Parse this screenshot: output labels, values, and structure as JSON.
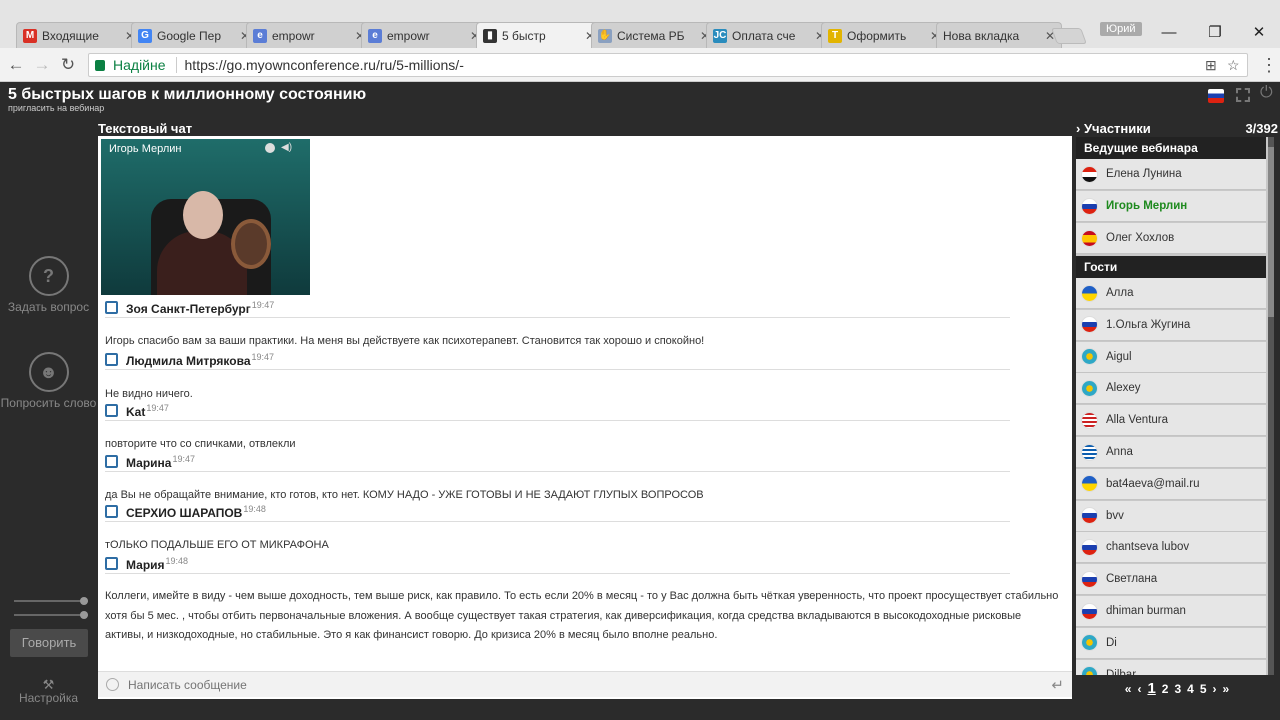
{
  "browser": {
    "tabs": [
      {
        "label": "Входящие",
        "icon": "gmail-icon",
        "color": "#d93025",
        "glyph": "M"
      },
      {
        "label": "Google Пер",
        "icon": "google-translate-icon",
        "color": "#4285f4",
        "glyph": "G"
      },
      {
        "label": "empowr",
        "icon": "empowr-icon",
        "color": "#5b7dd6",
        "glyph": "e"
      },
      {
        "label": "empowr",
        "icon": "empowr-icon",
        "color": "#5b7dd6",
        "glyph": "e"
      },
      {
        "label": "5 быстр",
        "icon": "myownconference-icon",
        "color": "#333333",
        "glyph": "▮"
      },
      {
        "label": "Система РБ",
        "icon": "hand-icon",
        "color": "#8aa0c0",
        "glyph": "✋"
      },
      {
        "label": "Оплата сче",
        "icon": "jc-icon",
        "color": "#2a8cbd",
        "glyph": "JC"
      },
      {
        "label": "Оформить",
        "icon": "shield-icon",
        "color": "#e2b400",
        "glyph": "T"
      },
      {
        "label": "Нова вкладка",
        "icon": "",
        "color": "",
        "glyph": ""
      }
    ],
    "user": "Юрий",
    "secure_label": "Надійне",
    "url": "https://go.myownconference.ru/ru/5-millions/-"
  },
  "app": {
    "title": "5 быстрых шагов к миллионному состоянию",
    "invite": "пригласить на вебинар",
    "ask_question": "Задать вопрос",
    "ask_word": "Попросить слово",
    "speak": "Говорить",
    "settings": "Настройка",
    "chat_label": "Текстовый чат",
    "speaker_name": "Игорь Мерлин",
    "input_placeholder": "Написать сообщение"
  },
  "chat": [
    {
      "author": "Зоя Санкт-Петербург",
      "time": "19:47",
      "text": "Игорь спасибо вам за ваши практики. На меня вы действуете как психотерапевт. Становится так хорошо и спокойно!"
    },
    {
      "author": "Людмила Митрякова",
      "time": "19:47",
      "text": "Не видно ничего."
    },
    {
      "author": "Kat",
      "time": "19:47",
      "text": "повторите что со спичками, отвлекли"
    },
    {
      "author": "Марина",
      "time": "19:47",
      "text": "да Вы не обращайте внимание, кто готов, кто нет. КОМУ НАДО - УЖЕ ГОТОВЫ И НЕ ЗАДАЮТ ГЛУПЫХ ВОПРОСОВ"
    },
    {
      "author": "СЕРХИО ШАРАПОВ",
      "time": "19:48",
      "text": "тОЛЬКО ПОДАЛЬШЕ ЕГО ОТ МИКРАФОНА"
    },
    {
      "author": "Мария",
      "time": "19:48",
      "text": "Коллеги, имейте в виду - чем выше доходность, тем выше риск, как правило. То есть если 20% в месяц - то у Вас должна быть чёткая уверенность, что проект просуществует стабильно хотя бы 5 мес. , чтобы отбить первоначальные вложения. А вообще существует такая стратегия, как диверсификация, когда средства вкладываются в высокодоходные рисковые активы, и низкодоходные, но стабильные.  Это я как финансист говорю. До кризиса 20% в месяц было вполне реально."
    }
  ],
  "participants": {
    "label": "Участники",
    "count": "3/392",
    "hosts_label": "Ведущие вебинара",
    "guests_label": "Гости",
    "hosts": [
      {
        "name": "Елена Лунина",
        "flag": "egypt",
        "bg": "linear-gradient(#d21 0 33%,#fff 33% 66%,#111 66%)",
        "active": false
      },
      {
        "name": "Игорь Мерлин",
        "flag": "russia",
        "bg": "linear-gradient(#fff 0 33%,#1b3fb0 33% 66%,#d21 66%)",
        "active": true
      },
      {
        "name": "Олег Хохлов",
        "flag": "spain",
        "bg": "linear-gradient(#c60b1e 0 25%,#ffc400 25% 75%,#c60b1e 75%)",
        "active": false
      }
    ],
    "guests": [
      {
        "name": "Алла",
        "flag": "ukraine",
        "bg": "linear-gradient(#1f5fc6 0 50%,#ffd500 50%)"
      },
      {
        "name": "1.Ольга Жугина",
        "flag": "russia",
        "bg": "linear-gradient(#fff 0 33%,#1b3fb0 33% 66%,#d21 66%)"
      },
      {
        "name": "Aigul",
        "flag": "kazakhstan",
        "bg": "radial-gradient(#f5c400 30%,#2ea8c6 32%)"
      },
      {
        "name": "Alexey",
        "flag": "kazakhstan",
        "bg": "radial-gradient(#f5c400 30%,#2ea8c6 32%)"
      },
      {
        "name": "Alla Ventura",
        "flag": "usa",
        "bg": "repeating-linear-gradient(#c22 0 2px,#fff 2px 4px)"
      },
      {
        "name": "Anna",
        "flag": "greece",
        "bg": "repeating-linear-gradient(#0d5eaf 0 2px,#fff 2px 4px)"
      },
      {
        "name": "bat4aeva@mail.ru",
        "flag": "ukraine",
        "bg": "linear-gradient(#1f5fc6 0 50%,#ffd500 50%)"
      },
      {
        "name": "bvv",
        "flag": "russia",
        "bg": "linear-gradient(#fff 0 33%,#1b3fb0 33% 66%,#d21 66%)"
      },
      {
        "name": "chantseva lubov",
        "flag": "russia",
        "bg": "linear-gradient(#fff 0 33%,#1b3fb0 33% 66%,#d21 66%)"
      },
      {
        "name": "Светлана",
        "flag": "russia",
        "bg": "linear-gradient(#fff 0 33%,#1b3fb0 33% 66%,#d21 66%)"
      },
      {
        "name": "dhiman burman",
        "flag": "russia",
        "bg": "linear-gradient(#fff 0 33%,#1b3fb0 33% 66%,#d21 66%)"
      },
      {
        "name": "Di",
        "flag": "kazakhstan",
        "bg": "radial-gradient(#f5c400 30%,#2ea8c6 32%)"
      },
      {
        "name": "Dilbar",
        "flag": "kazakhstan",
        "bg": "radial-gradient(#f5c400 30%,#2ea8c6 32%)"
      }
    ],
    "pager": [
      "«",
      "‹",
      "1",
      "2",
      "3",
      "4",
      "5",
      "›",
      "»"
    ],
    "current_page": "1"
  },
  "colors": {
    "active_host": "#1e8a1e",
    "link_blue": "#2e6da4"
  }
}
